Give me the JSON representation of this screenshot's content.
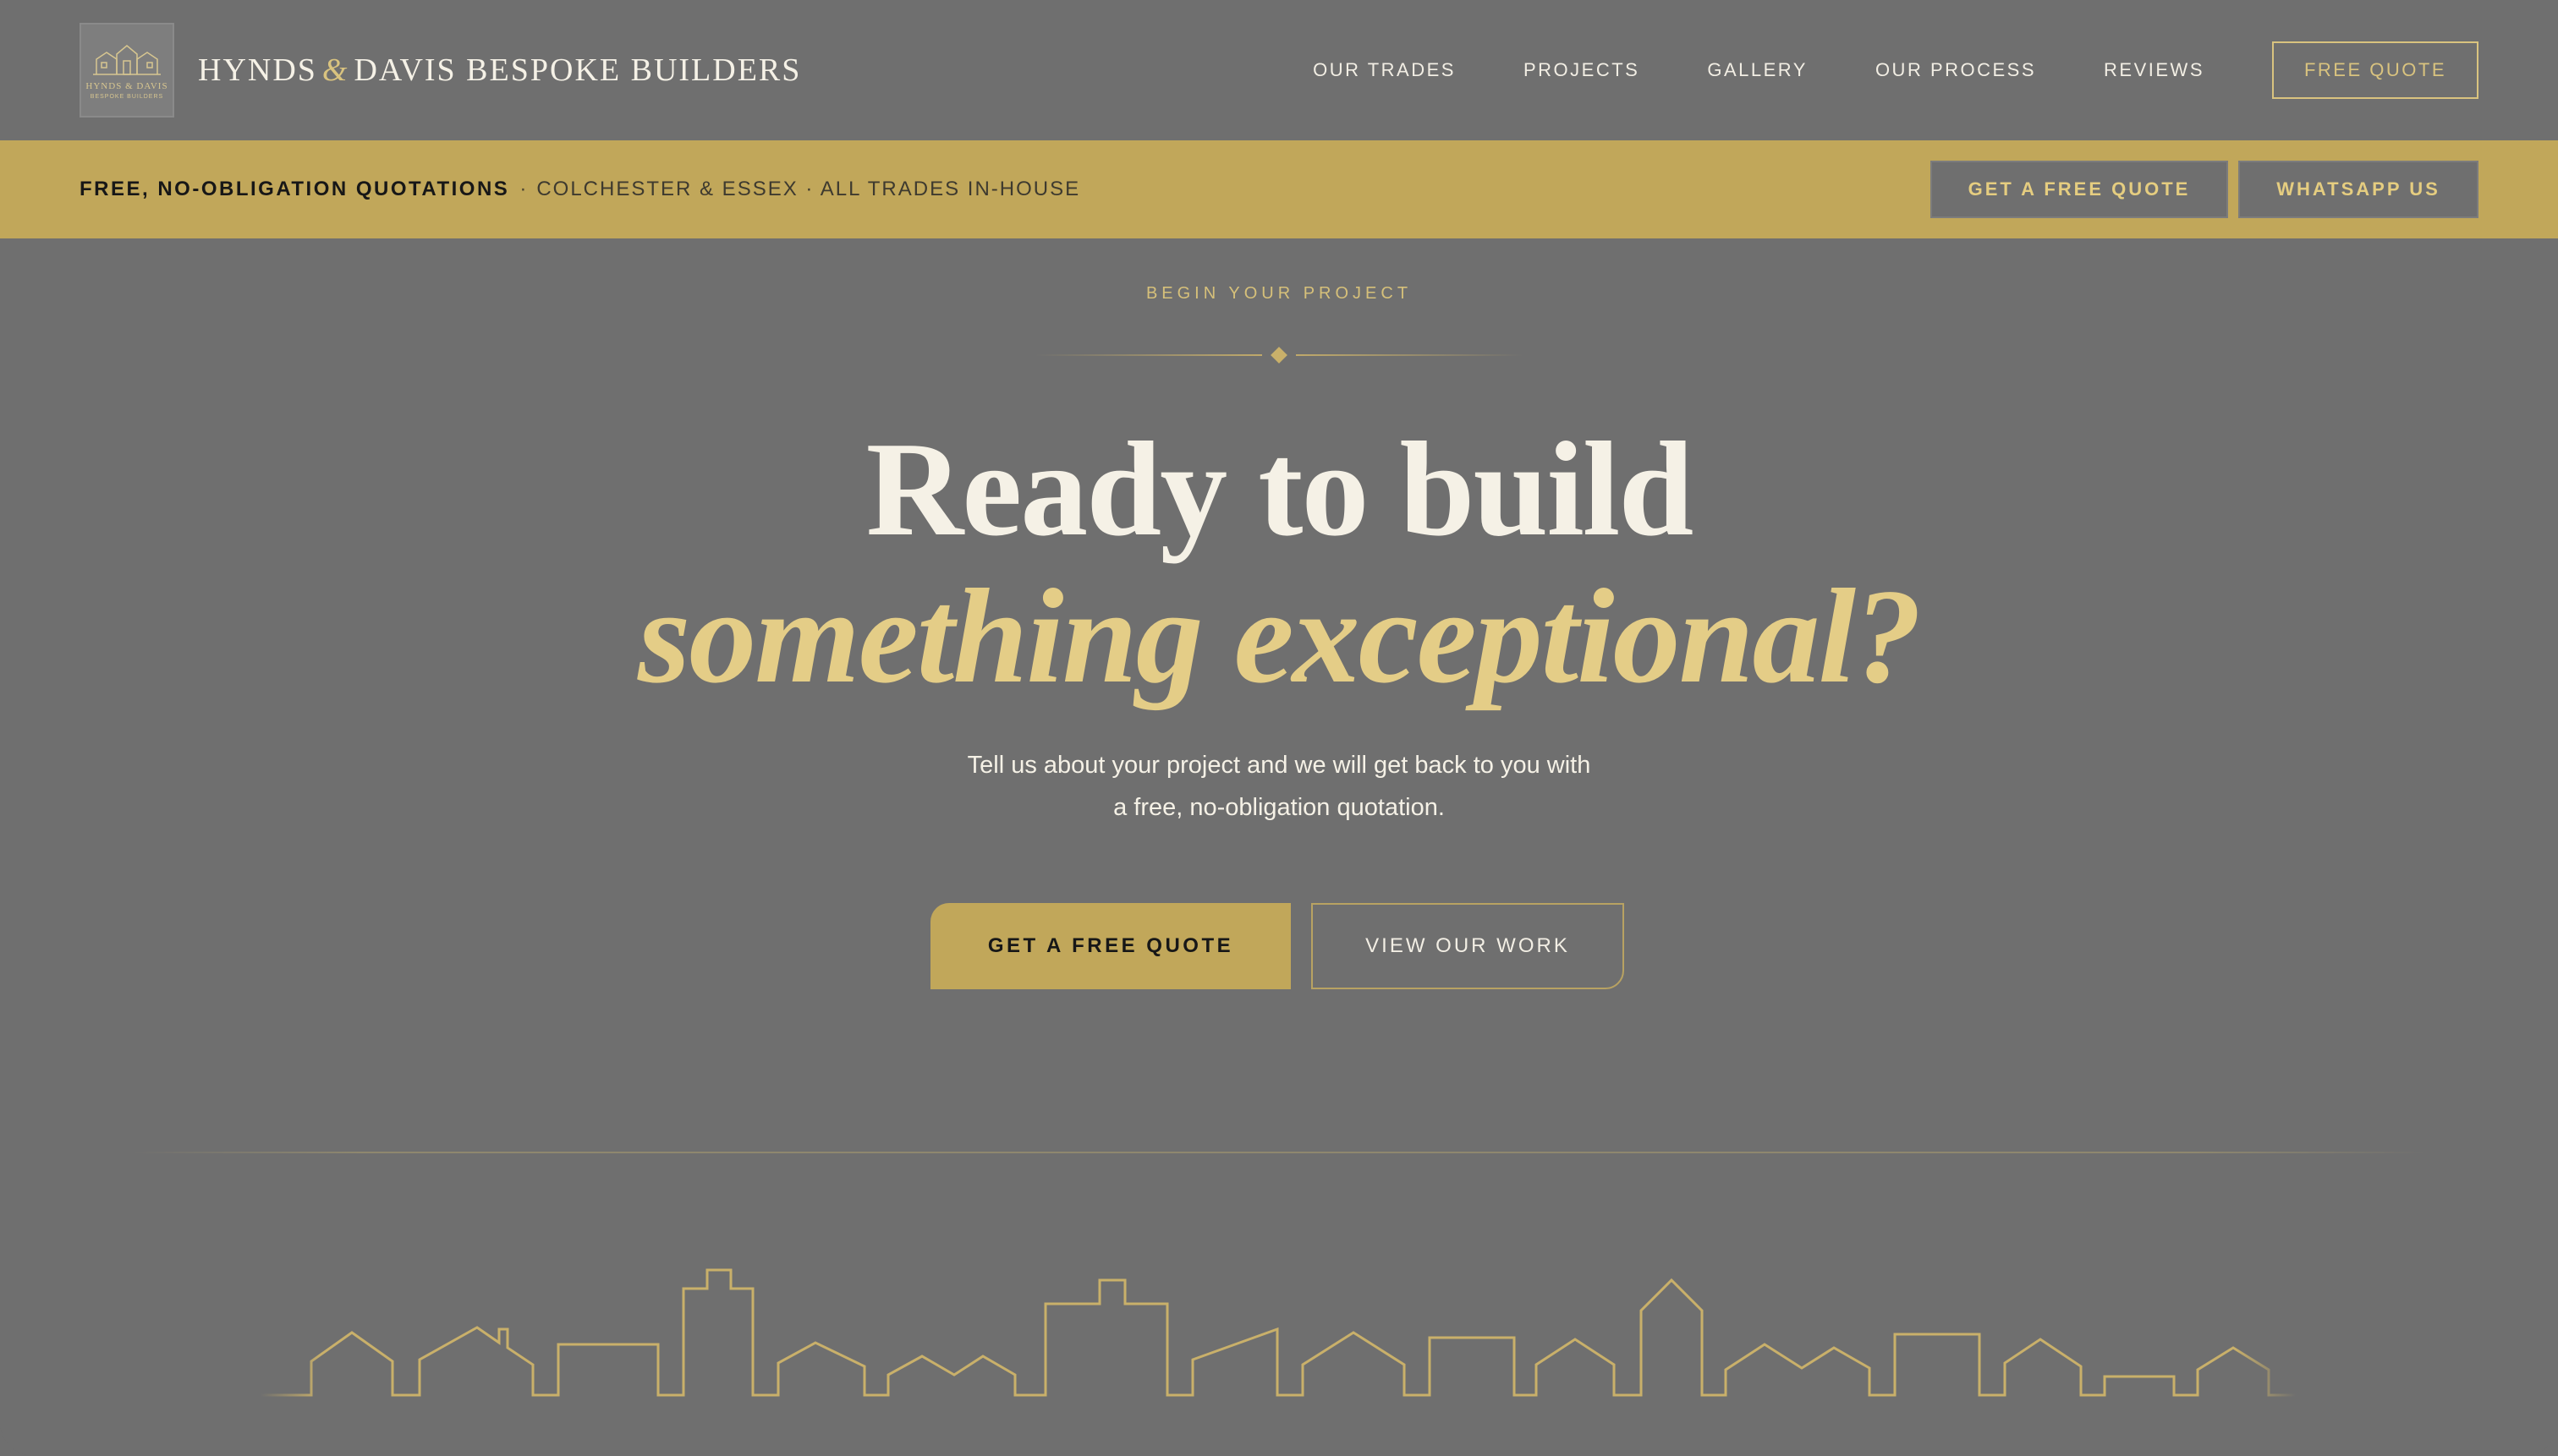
{
  "header": {
    "logo_text": "HYNDS & DAVIS",
    "logo_subtext": "BESPOKE BUILDERS",
    "brand_left": "HYNDS",
    "brand_amp": "&",
    "brand_right": "DAVIS BESPOKE BUILDERS",
    "nav": [
      {
        "label": "OUR TRADES"
      },
      {
        "label": "PROJECTS"
      },
      {
        "label": "GALLERY"
      },
      {
        "label": "OUR PROCESS"
      },
      {
        "label": "REVIEWS"
      }
    ],
    "cta_label": "FREE QUOTE"
  },
  "banner": {
    "strong": "FREE, NO-OBLIGATION QUOTATIONS",
    "sep": "·",
    "text": "COLCHESTER & ESSEX · ALL TRADES IN-HOUSE",
    "quote_button": "GET A FREE QUOTE",
    "whatsapp_button": "WHATSAPP US"
  },
  "hero": {
    "eyebrow": "BEGIN YOUR PROJECT",
    "headline_line1": "Ready to build",
    "headline_line2": "something exceptional?",
    "sub_line1": "Tell us about your project and we will get back to you with",
    "sub_line2": "a free, no-obligation quotation.",
    "primary_cta": "GET A FREE QUOTE",
    "secondary_cta": "VIEW OUR WORK"
  },
  "colors": {
    "background": "#6f6f6f",
    "gold": "#c1a75a",
    "gold_light": "#e4cd87",
    "text": "#f5f1e6"
  },
  "icons": {
    "logo": "house-crest-icon",
    "divider": "diamond-icon",
    "skyline": "skyline-illustration"
  }
}
